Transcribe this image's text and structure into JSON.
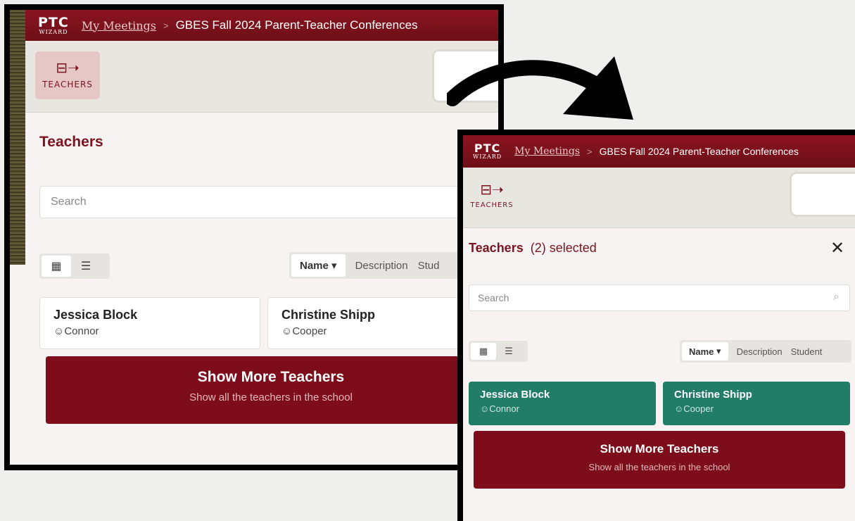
{
  "before": {
    "logo": {
      "mark": "PTC",
      "sub": "WIZARD"
    },
    "breadcrumb": {
      "link": "My Meetings",
      "separator": ">",
      "current": "GBES Fall 2024 Parent-Teacher Conferences"
    },
    "toolbar": {
      "teachers_label": "TEACHERS"
    },
    "heading": "Teachers",
    "search_placeholder": "Search",
    "sort": {
      "active": "Name",
      "options": [
        "Description",
        "Stud"
      ]
    },
    "cards": [
      {
        "name": "Jessica Block",
        "student": "Connor"
      },
      {
        "name": "Christine Shipp",
        "student": "Cooper"
      }
    ],
    "show_more": {
      "title": "Show More Teachers",
      "subtitle": "Show all the teachers in the school"
    }
  },
  "after": {
    "logo": {
      "mark": "PTC",
      "sub": "WIZARD"
    },
    "breadcrumb": {
      "link": "My Meetings",
      "separator": ">",
      "current": "GBES Fall 2024 Parent-Teacher Conferences"
    },
    "toolbar": {
      "teachers_label": "TEACHERS"
    },
    "heading": "Teachers",
    "selected_text": "(2) selected",
    "search_placeholder": "Search",
    "sort": {
      "active": "Name",
      "options": [
        "Description",
        "Student"
      ]
    },
    "cards": [
      {
        "name": "Jessica Block",
        "student": "Connor"
      },
      {
        "name": "Christine Shipp",
        "student": "Cooper"
      }
    ],
    "show_more": {
      "title": "Show More Teachers",
      "subtitle": "Show all the teachers in the school"
    }
  },
  "colors": {
    "brand": "#7e0d1b",
    "selected": "#227d66"
  }
}
